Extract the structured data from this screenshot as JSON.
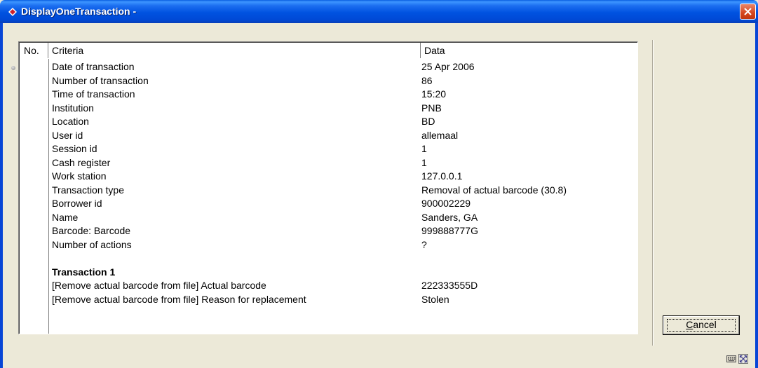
{
  "window": {
    "title": "DisplayOneTransaction -"
  },
  "grid": {
    "columns": [
      "No.",
      "Criteria",
      "Data"
    ],
    "rows": [
      {
        "criteria": "Date of transaction",
        "data": "25 Apr 2006"
      },
      {
        "criteria": "Number of transaction",
        "data": "86"
      },
      {
        "criteria": "Time of transaction",
        "data": "15:20"
      },
      {
        "criteria": "Institution",
        "data": "PNB"
      },
      {
        "criteria": "Location",
        "data": "BD"
      },
      {
        "criteria": "User id",
        "data": "allemaal"
      },
      {
        "criteria": "Session id",
        "data": "1"
      },
      {
        "criteria": "Cash register",
        "data": "1"
      },
      {
        "criteria": "Work station",
        "data": "127.0.0.1"
      },
      {
        "criteria": "Transaction type",
        "data": "Removal of actual barcode (30.8)"
      },
      {
        "criteria": "Borrower id",
        "data": "900002229"
      },
      {
        "criteria": "Name",
        "data": "Sanders, GA"
      },
      {
        "criteria": "Barcode: Barcode",
        "data": "999888777G"
      },
      {
        "criteria": "Number of actions",
        "data": "?"
      },
      {
        "criteria": "",
        "data": ""
      },
      {
        "criteria": "Transaction 1",
        "data": "",
        "bold": true
      },
      {
        "criteria": "[Remove actual barcode from file] Actual barcode",
        "data": "222333555D"
      },
      {
        "criteria": "[Remove actual barcode from file] Reason for replacement",
        "data": "Stolen"
      }
    ]
  },
  "buttons": {
    "cancel_hotkey": "C",
    "cancel_rest": "ancel"
  },
  "icons": {
    "app": "diamond-app-icon",
    "close": "close-icon",
    "status1": "keyboard-icon",
    "status2": "resize-icon"
  },
  "colors": {
    "titlebar": "#0054e3",
    "close": "#d5461e",
    "dialog_bg": "#ece9d8"
  }
}
